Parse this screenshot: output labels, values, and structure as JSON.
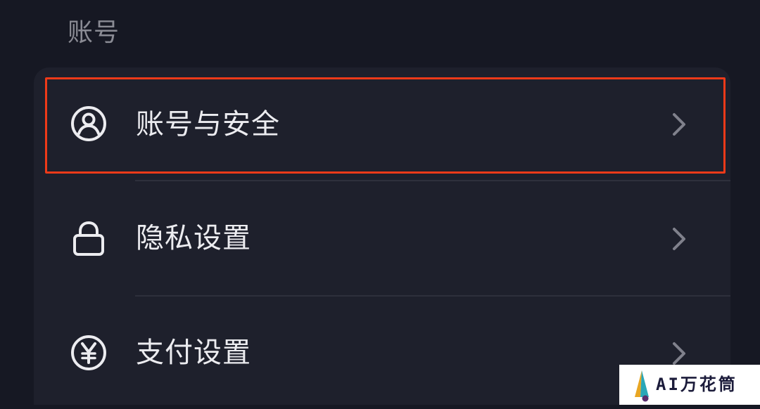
{
  "section": {
    "title": "账号"
  },
  "settings": {
    "items": [
      {
        "label": "账号与安全",
        "icon": "user-circle-icon",
        "highlighted": true
      },
      {
        "label": "隐私设置",
        "icon": "lock-icon",
        "highlighted": false
      },
      {
        "label": "支付设置",
        "icon": "yuan-circle-icon",
        "highlighted": false
      }
    ]
  },
  "watermark": {
    "text": "AI万花筒"
  },
  "colors": {
    "background": "#161823",
    "card": "#1e202c",
    "highlight_border": "#ee3a19",
    "label": "#ececf0",
    "section_title": "#8a8b94",
    "chevron": "#80818c"
  }
}
